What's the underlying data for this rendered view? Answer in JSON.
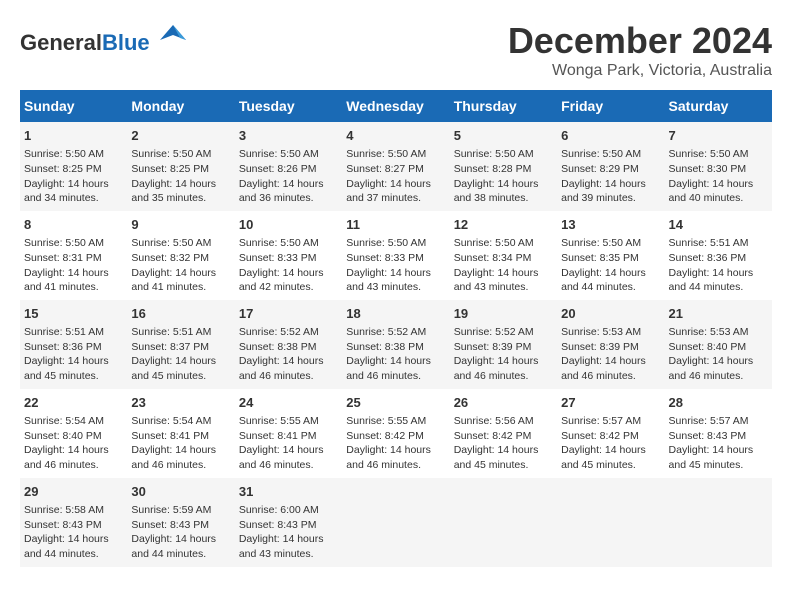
{
  "logo": {
    "general": "General",
    "blue": "Blue"
  },
  "title": "December 2024",
  "location": "Wonga Park, Victoria, Australia",
  "days_of_week": [
    "Sunday",
    "Monday",
    "Tuesday",
    "Wednesday",
    "Thursday",
    "Friday",
    "Saturday"
  ],
  "weeks": [
    [
      {
        "day": "1",
        "sunrise": "Sunrise: 5:50 AM",
        "sunset": "Sunset: 8:25 PM",
        "daylight": "Daylight: 14 hours and 34 minutes."
      },
      {
        "day": "2",
        "sunrise": "Sunrise: 5:50 AM",
        "sunset": "Sunset: 8:25 PM",
        "daylight": "Daylight: 14 hours and 35 minutes."
      },
      {
        "day": "3",
        "sunrise": "Sunrise: 5:50 AM",
        "sunset": "Sunset: 8:26 PM",
        "daylight": "Daylight: 14 hours and 36 minutes."
      },
      {
        "day": "4",
        "sunrise": "Sunrise: 5:50 AM",
        "sunset": "Sunset: 8:27 PM",
        "daylight": "Daylight: 14 hours and 37 minutes."
      },
      {
        "day": "5",
        "sunrise": "Sunrise: 5:50 AM",
        "sunset": "Sunset: 8:28 PM",
        "daylight": "Daylight: 14 hours and 38 minutes."
      },
      {
        "day": "6",
        "sunrise": "Sunrise: 5:50 AM",
        "sunset": "Sunset: 8:29 PM",
        "daylight": "Daylight: 14 hours and 39 minutes."
      },
      {
        "day": "7",
        "sunrise": "Sunrise: 5:50 AM",
        "sunset": "Sunset: 8:30 PM",
        "daylight": "Daylight: 14 hours and 40 minutes."
      }
    ],
    [
      {
        "day": "8",
        "sunrise": "Sunrise: 5:50 AM",
        "sunset": "Sunset: 8:31 PM",
        "daylight": "Daylight: 14 hours and 41 minutes."
      },
      {
        "day": "9",
        "sunrise": "Sunrise: 5:50 AM",
        "sunset": "Sunset: 8:32 PM",
        "daylight": "Daylight: 14 hours and 41 minutes."
      },
      {
        "day": "10",
        "sunrise": "Sunrise: 5:50 AM",
        "sunset": "Sunset: 8:33 PM",
        "daylight": "Daylight: 14 hours and 42 minutes."
      },
      {
        "day": "11",
        "sunrise": "Sunrise: 5:50 AM",
        "sunset": "Sunset: 8:33 PM",
        "daylight": "Daylight: 14 hours and 43 minutes."
      },
      {
        "day": "12",
        "sunrise": "Sunrise: 5:50 AM",
        "sunset": "Sunset: 8:34 PM",
        "daylight": "Daylight: 14 hours and 43 minutes."
      },
      {
        "day": "13",
        "sunrise": "Sunrise: 5:50 AM",
        "sunset": "Sunset: 8:35 PM",
        "daylight": "Daylight: 14 hours and 44 minutes."
      },
      {
        "day": "14",
        "sunrise": "Sunrise: 5:51 AM",
        "sunset": "Sunset: 8:36 PM",
        "daylight": "Daylight: 14 hours and 44 minutes."
      }
    ],
    [
      {
        "day": "15",
        "sunrise": "Sunrise: 5:51 AM",
        "sunset": "Sunset: 8:36 PM",
        "daylight": "Daylight: 14 hours and 45 minutes."
      },
      {
        "day": "16",
        "sunrise": "Sunrise: 5:51 AM",
        "sunset": "Sunset: 8:37 PM",
        "daylight": "Daylight: 14 hours and 45 minutes."
      },
      {
        "day": "17",
        "sunrise": "Sunrise: 5:52 AM",
        "sunset": "Sunset: 8:38 PM",
        "daylight": "Daylight: 14 hours and 46 minutes."
      },
      {
        "day": "18",
        "sunrise": "Sunrise: 5:52 AM",
        "sunset": "Sunset: 8:38 PM",
        "daylight": "Daylight: 14 hours and 46 minutes."
      },
      {
        "day": "19",
        "sunrise": "Sunrise: 5:52 AM",
        "sunset": "Sunset: 8:39 PM",
        "daylight": "Daylight: 14 hours and 46 minutes."
      },
      {
        "day": "20",
        "sunrise": "Sunrise: 5:53 AM",
        "sunset": "Sunset: 8:39 PM",
        "daylight": "Daylight: 14 hours and 46 minutes."
      },
      {
        "day": "21",
        "sunrise": "Sunrise: 5:53 AM",
        "sunset": "Sunset: 8:40 PM",
        "daylight": "Daylight: 14 hours and 46 minutes."
      }
    ],
    [
      {
        "day": "22",
        "sunrise": "Sunrise: 5:54 AM",
        "sunset": "Sunset: 8:40 PM",
        "daylight": "Daylight: 14 hours and 46 minutes."
      },
      {
        "day": "23",
        "sunrise": "Sunrise: 5:54 AM",
        "sunset": "Sunset: 8:41 PM",
        "daylight": "Daylight: 14 hours and 46 minutes."
      },
      {
        "day": "24",
        "sunrise": "Sunrise: 5:55 AM",
        "sunset": "Sunset: 8:41 PM",
        "daylight": "Daylight: 14 hours and 46 minutes."
      },
      {
        "day": "25",
        "sunrise": "Sunrise: 5:55 AM",
        "sunset": "Sunset: 8:42 PM",
        "daylight": "Daylight: 14 hours and 46 minutes."
      },
      {
        "day": "26",
        "sunrise": "Sunrise: 5:56 AM",
        "sunset": "Sunset: 8:42 PM",
        "daylight": "Daylight: 14 hours and 45 minutes."
      },
      {
        "day": "27",
        "sunrise": "Sunrise: 5:57 AM",
        "sunset": "Sunset: 8:42 PM",
        "daylight": "Daylight: 14 hours and 45 minutes."
      },
      {
        "day": "28",
        "sunrise": "Sunrise: 5:57 AM",
        "sunset": "Sunset: 8:43 PM",
        "daylight": "Daylight: 14 hours and 45 minutes."
      }
    ],
    [
      {
        "day": "29",
        "sunrise": "Sunrise: 5:58 AM",
        "sunset": "Sunset: 8:43 PM",
        "daylight": "Daylight: 14 hours and 44 minutes."
      },
      {
        "day": "30",
        "sunrise": "Sunrise: 5:59 AM",
        "sunset": "Sunset: 8:43 PM",
        "daylight": "Daylight: 14 hours and 44 minutes."
      },
      {
        "day": "31",
        "sunrise": "Sunrise: 6:00 AM",
        "sunset": "Sunset: 8:43 PM",
        "daylight": "Daylight: 14 hours and 43 minutes."
      },
      {
        "day": "",
        "sunrise": "",
        "sunset": "",
        "daylight": ""
      },
      {
        "day": "",
        "sunrise": "",
        "sunset": "",
        "daylight": ""
      },
      {
        "day": "",
        "sunrise": "",
        "sunset": "",
        "daylight": ""
      },
      {
        "day": "",
        "sunrise": "",
        "sunset": "",
        "daylight": ""
      }
    ]
  ]
}
